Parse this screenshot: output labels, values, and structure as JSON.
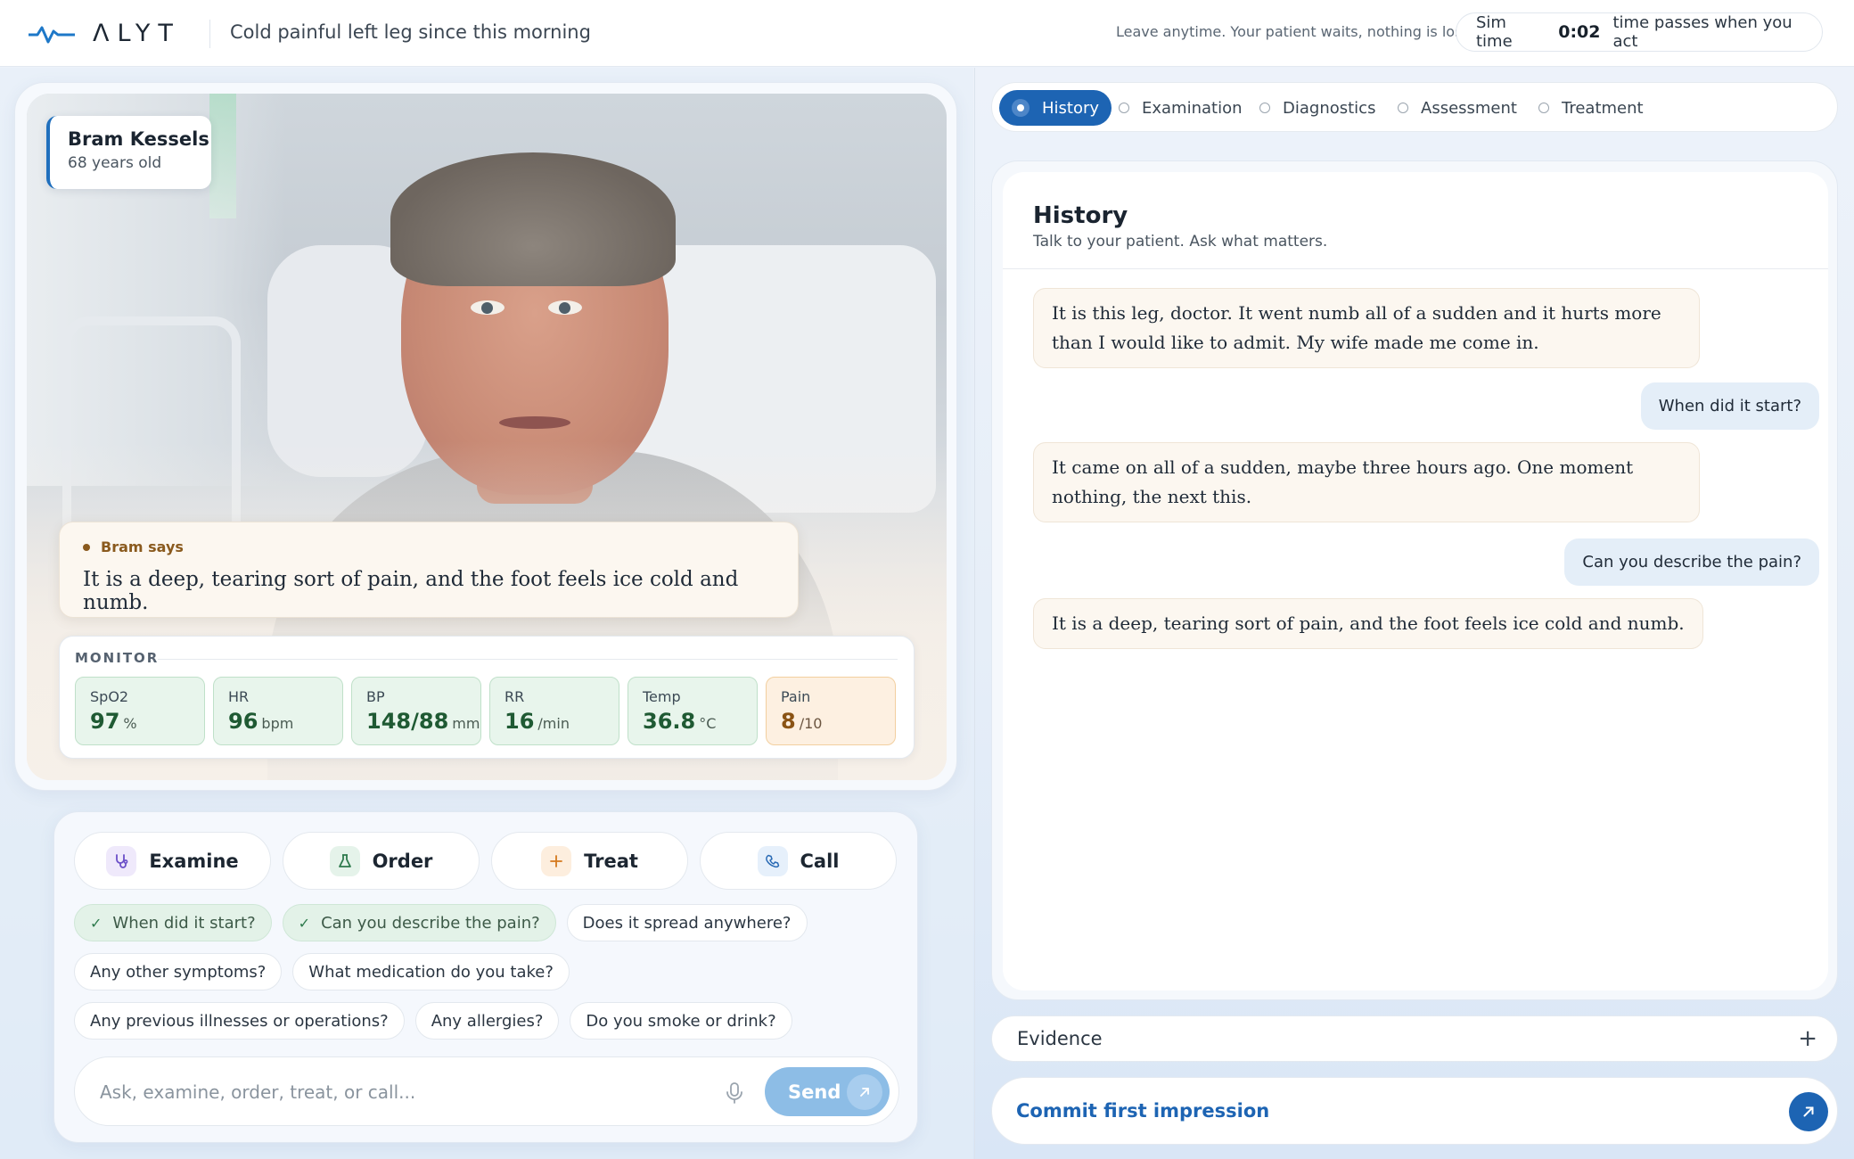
{
  "header": {
    "logo_text": "ΛLYT",
    "case_title": "Cold painful left leg since this morning",
    "leave_note": "Leave anytime. Your patient waits, nothing is lost.",
    "sim_label": "Sim time",
    "sim_value": "0:02",
    "sim_note": "time passes when you act"
  },
  "patient": {
    "name": "Bram Kessels",
    "age": "68 years old"
  },
  "speech": {
    "label": "Bram says",
    "text": "It is a deep, tearing sort of pain, and the foot feels ice cold and numb."
  },
  "monitor": {
    "label": "MONITOR",
    "vitals": [
      {
        "label": "SpO2",
        "value": "97",
        "unit": "%"
      },
      {
        "label": "HR",
        "value": "96",
        "unit": "bpm"
      },
      {
        "label": "BP",
        "value": "148/88",
        "unit": "mmHg"
      },
      {
        "label": "RR",
        "value": "16",
        "unit": "/min"
      },
      {
        "label": "Temp",
        "value": "36.8",
        "unit": "°C"
      },
      {
        "label": "Pain",
        "value": "8",
        "unit": "/10"
      }
    ]
  },
  "actions": [
    {
      "label": "Examine",
      "icon": "stethoscope-icon"
    },
    {
      "label": "Order",
      "icon": "flask-icon"
    },
    {
      "label": "Treat",
      "icon": "plus-icon"
    },
    {
      "label": "Call",
      "icon": "phone-icon"
    }
  ],
  "suggestions": [
    {
      "label": "When did it start?",
      "asked": true
    },
    {
      "label": "Can you describe the pain?",
      "asked": true
    },
    {
      "label": "Does it spread anywhere?",
      "asked": false
    },
    {
      "label": "Any other symptoms?",
      "asked": false
    },
    {
      "label": "What medication do you take?",
      "asked": false
    },
    {
      "label": "Any previous illnesses or operations?",
      "asked": false
    },
    {
      "label": "Any allergies?",
      "asked": false
    },
    {
      "label": "Do you smoke or drink?",
      "asked": false
    }
  ],
  "composer": {
    "placeholder": "Ask, examine, order, treat, or call...",
    "send_label": "Send"
  },
  "tabs": [
    {
      "label": "History",
      "active": true
    },
    {
      "label": "Examination",
      "active": false
    },
    {
      "label": "Diagnostics",
      "active": false
    },
    {
      "label": "Assessment",
      "active": false
    },
    {
      "label": "Treatment",
      "active": false
    }
  ],
  "history": {
    "title": "History",
    "subtitle": "Talk to your patient. Ask what matters.",
    "messages": [
      {
        "from": "patient",
        "text": "It is this leg, doctor. It went numb all of a sudden and it hurts more than I would like to admit. My wife made me come in."
      },
      {
        "from": "doctor",
        "text": "When did it start?"
      },
      {
        "from": "patient",
        "text": "It came on all of a sudden, maybe three hours ago. One moment nothing, the next this."
      },
      {
        "from": "doctor",
        "text": "Can you describe the pain?"
      },
      {
        "from": "patient",
        "text": "It is a deep, tearing sort of pain, and the foot feels ice cold and numb."
      }
    ]
  },
  "evidence": {
    "label": "Evidence"
  },
  "commit": {
    "label": "Commit first impression"
  },
  "colors": {
    "accent": "#1d64b3",
    "vital_ok": "#e8f5ec",
    "vital_warn": "#fdf0e1",
    "patient_bubble": "#fcf7f0",
    "doctor_bubble": "#e4eef8"
  }
}
